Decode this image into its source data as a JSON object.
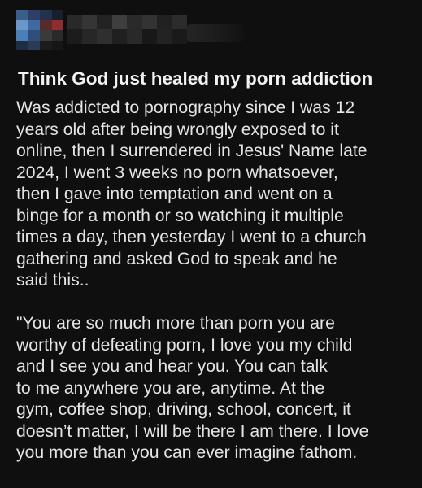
{
  "post": {
    "author": {
      "avatar_colors": [
        [
          "#3b5f8a",
          "#2d3f66",
          "#23304e",
          "#1a1f2e"
        ],
        [
          "#6a96c8",
          "#3e6aa0",
          "#5a2a2a",
          "#8e2e2e"
        ],
        [
          "#4a7fb8",
          "#2f4e7a",
          "#3a3a3a",
          "#2a2a2a"
        ],
        [
          "#1e2c44",
          "#2b3b55",
          "#1c1c1c",
          "#161616"
        ]
      ],
      "name_colors": [
        [
          "#2c2c2c",
          "#3a3a3a",
          "#262626",
          "#444444",
          "#2e2e2e",
          "#383838",
          "#242424",
          "#303030"
        ],
        [
          "#1e1e1e",
          "#2a2a2a",
          "#333333",
          "#222222",
          "#2c2c2c",
          "#1a1a1a",
          "#262626",
          "#1c1c1c"
        ]
      ]
    },
    "title": "Think God just healed my porn addiction",
    "paragraph1": [
      "Was addicted to pornography since I was 12",
      "years old after being wrongly exposed to it",
      "online, then I surrendered in Jesus' Name late",
      "2024, I went 3 weeks no porn whatsoever,",
      "then I gave into temptation and went on a",
      "binge for a month or so watching it multiple",
      "times a day, then yesterday I went to a church",
      "gathering and asked God to speak and he",
      "said this.."
    ],
    "paragraph2": [
      "\"You are so much more than porn you are",
      "worthy of defeating porn, I love you my child",
      "and I see you and hear you. You can talk",
      "to me anywhere you are, anytime. At the",
      "gym, coffee shop, driving, school, concert, it",
      "doesn’t matter, I will be there I am there. I love",
      "you more than you can ever imagine fathom."
    ]
  }
}
